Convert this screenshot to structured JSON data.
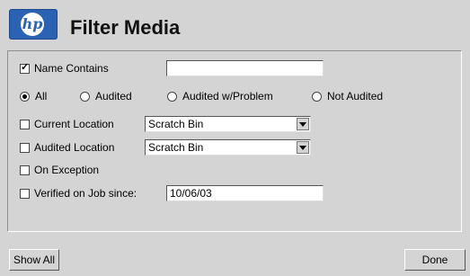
{
  "header": {
    "logo_text": "hp",
    "title": "Filter Media"
  },
  "name_contains": {
    "label": "Name Contains",
    "checked": true,
    "value": ""
  },
  "audit_options": [
    {
      "label": "All",
      "selected": true
    },
    {
      "label": "Audited",
      "selected": false
    },
    {
      "label": "Audited w/Problem",
      "selected": false
    },
    {
      "label": "Not Audited",
      "selected": false
    }
  ],
  "current_location": {
    "label": "Current Location",
    "checked": false,
    "value": "Scratch Bin"
  },
  "audited_location": {
    "label": "Audited Location",
    "checked": false,
    "value": "Scratch Bin"
  },
  "on_exception": {
    "label": "On Exception",
    "checked": false
  },
  "verified": {
    "label": "Verified on Job since:",
    "checked": false,
    "value": "10/06/03"
  },
  "buttons": {
    "show_all": "Show All",
    "done": "Done"
  },
  "colors": {
    "logo_blue": "#2b62b4",
    "background": "#d4d4d4"
  }
}
